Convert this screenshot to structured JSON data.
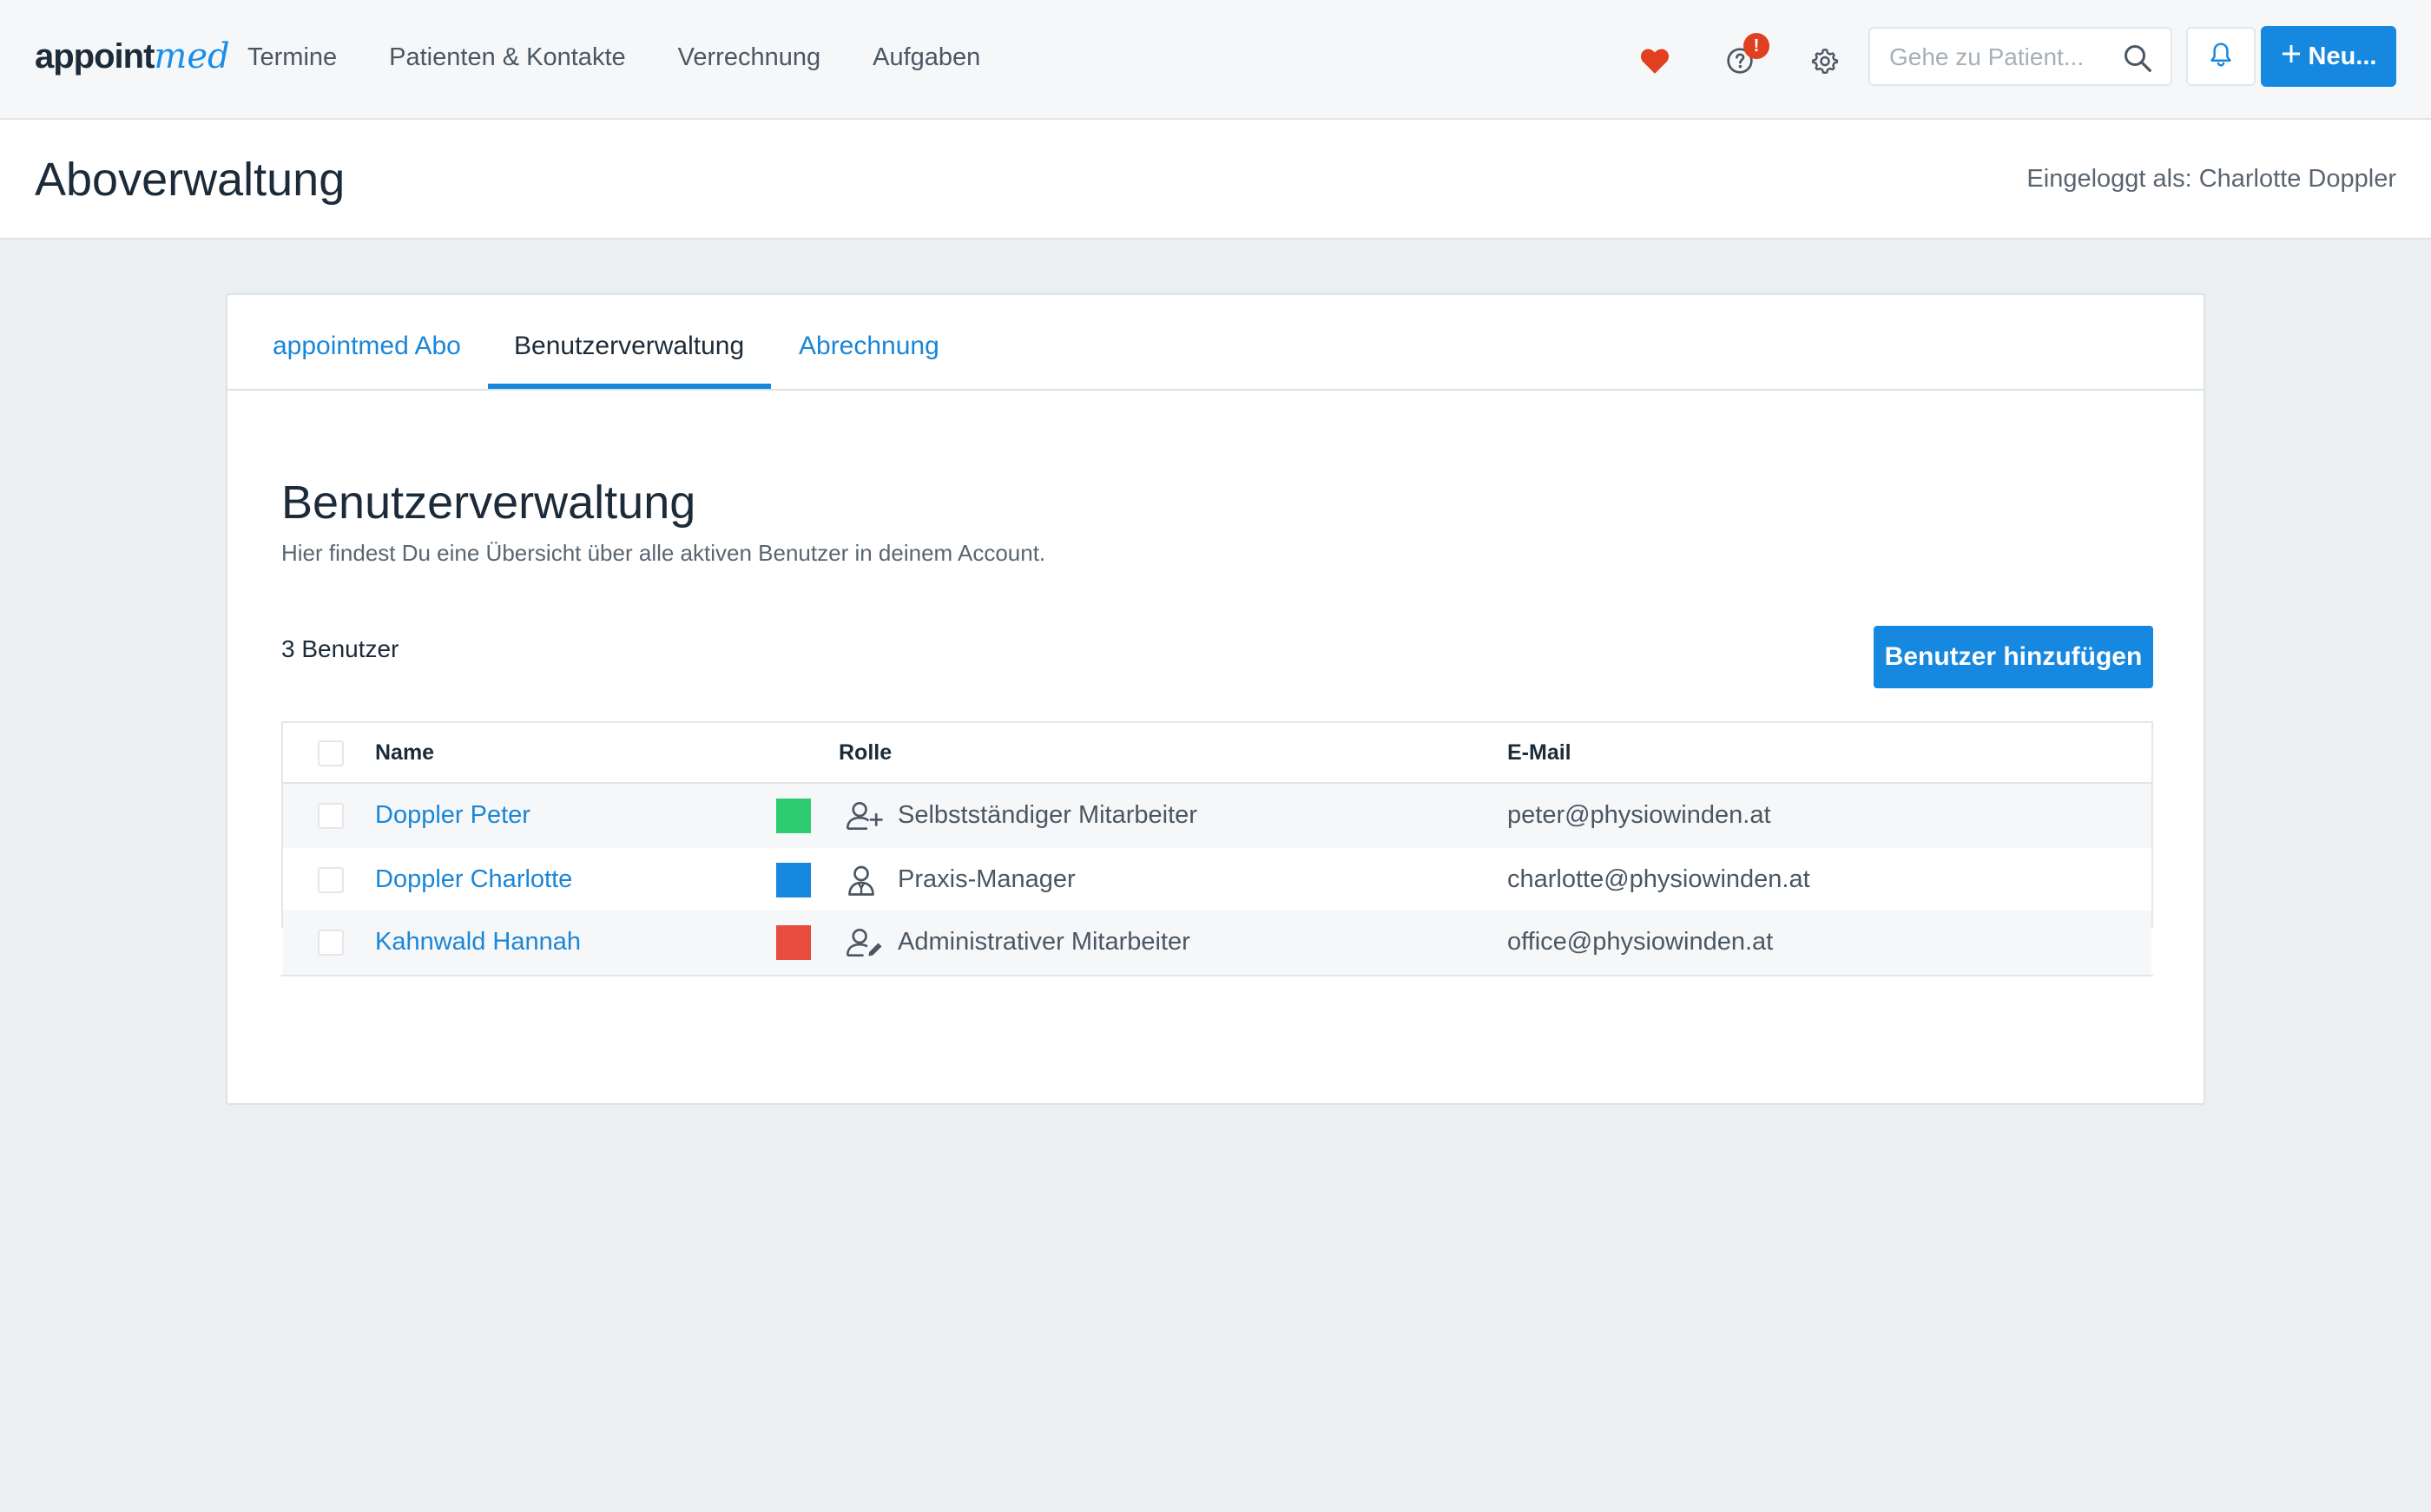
{
  "topbar": {
    "logo_main": "appoint",
    "logo_accent": "med",
    "nav": [
      "Termine",
      "Patienten & Kontakte",
      "Verrechnung",
      "Aufgaben"
    ],
    "notification_badge": "!",
    "search_placeholder": "Gehe zu Patient...",
    "new_button_label": "Neu..."
  },
  "page": {
    "title": "Aboverwaltung",
    "logged_in": "Eingeloggt als: Charlotte Doppler"
  },
  "tabs": [
    {
      "label": "appointmed Abo",
      "active": false
    },
    {
      "label": "Benutzerverwaltung",
      "active": true
    },
    {
      "label": "Abrechnung",
      "active": false
    }
  ],
  "section": {
    "title": "Benutzerverwaltung",
    "subtitle": "Hier findest Du eine Übersicht über alle aktiven Benutzer in deinem Account.",
    "count": "3 Benutzer",
    "add_button": "Benutzer hinzufügen"
  },
  "table": {
    "headers": {
      "name": "Name",
      "role": "Rolle",
      "email": "E-Mail"
    },
    "rows": [
      {
        "name": "Doppler Peter",
        "color": "#2ecc71",
        "role_icon": "user-plus-icon",
        "role": "Selbstständiger Mitarbeiter",
        "email": "peter@physiowinden.at"
      },
      {
        "name": "Doppler Charlotte",
        "color": "#1688e0",
        "role_icon": "user-manager-icon",
        "role": "Praxis-Manager",
        "email": "charlotte@physiowinden.at"
      },
      {
        "name": "Kahnwald Hannah",
        "color": "#e74c3c",
        "role_icon": "user-edit-icon",
        "role": "Administrativer Mitarbeiter",
        "email": "office@physiowinden.at"
      }
    ]
  },
  "colors": {
    "accent": "#1688e0",
    "heart": "#e0401f"
  }
}
